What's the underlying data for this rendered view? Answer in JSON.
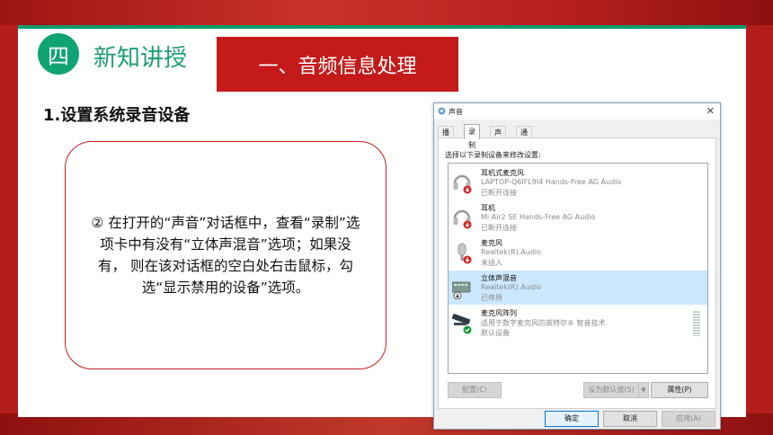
{
  "header": {
    "badge_text": "四",
    "section_title": "新知讲授",
    "banner_title": "一、音频信息处理"
  },
  "subheading": "1.设置系统录音设备",
  "note": {
    "text": "② 在打开的“声音”对话框中，查看“录制”选项卡中有没有“立体声混音”选项；如果没有， 则在该对话框的空白处右击鼠标，勾选“显示禁用的设备”选项。"
  },
  "dialog": {
    "title": "声音",
    "close_glyph": "✕",
    "tabs": [
      {
        "label": "播放"
      },
      {
        "label": "录制"
      },
      {
        "label": "声音"
      },
      {
        "label": "通信"
      }
    ],
    "active_tab": "录制",
    "instruction": "选择以下录制设备来修改设置:",
    "devices": [
      {
        "name": "耳机式麦克风",
        "desc": "LAPTOP-Q6IFL9I4 Hands-Free AG Audio",
        "status": "已断开连接",
        "icon": "headset-icon",
        "badge": "disconnected-badge-icon"
      },
      {
        "name": "耳机",
        "desc": "Mi Air2 SE Hands-Free AG Audio",
        "status": "已断开连接",
        "icon": "headset-icon",
        "badge": "disconnected-badge-icon"
      },
      {
        "name": "麦克风",
        "desc": "Realtek(R) Audio",
        "status": "未插入",
        "icon": "microphone-icon",
        "badge": "unplugged-badge-icon"
      },
      {
        "name": "立体声混音",
        "desc": "Realtek(R) Audio",
        "status": "已停用",
        "icon": "stereo-mix-icon",
        "badge": "disabled-badge-icon"
      },
      {
        "name": "麦克风阵列",
        "desc": "适用于数字麦克风的英特尔® 智音技术",
        "status": "默认设备",
        "icon": "mic-array-icon",
        "badge": "default-check-icon"
      }
    ],
    "selected_device": "立体声混音",
    "buttons": {
      "configure": "配置(C)",
      "set_default": "设为默认值(S)",
      "set_default_arrow": "▼",
      "properties": "属性(P)",
      "ok": "确定",
      "cancel": "取消",
      "apply": "应用(A)"
    },
    "colors": {
      "selection": "#cce8ff",
      "default_check": "#1a9a3c",
      "disconnected": "#d32626"
    }
  },
  "colors": {
    "brand_green": "#10a373",
    "banner_red": "#c51a1a",
    "box_border": "#c21f1f"
  }
}
